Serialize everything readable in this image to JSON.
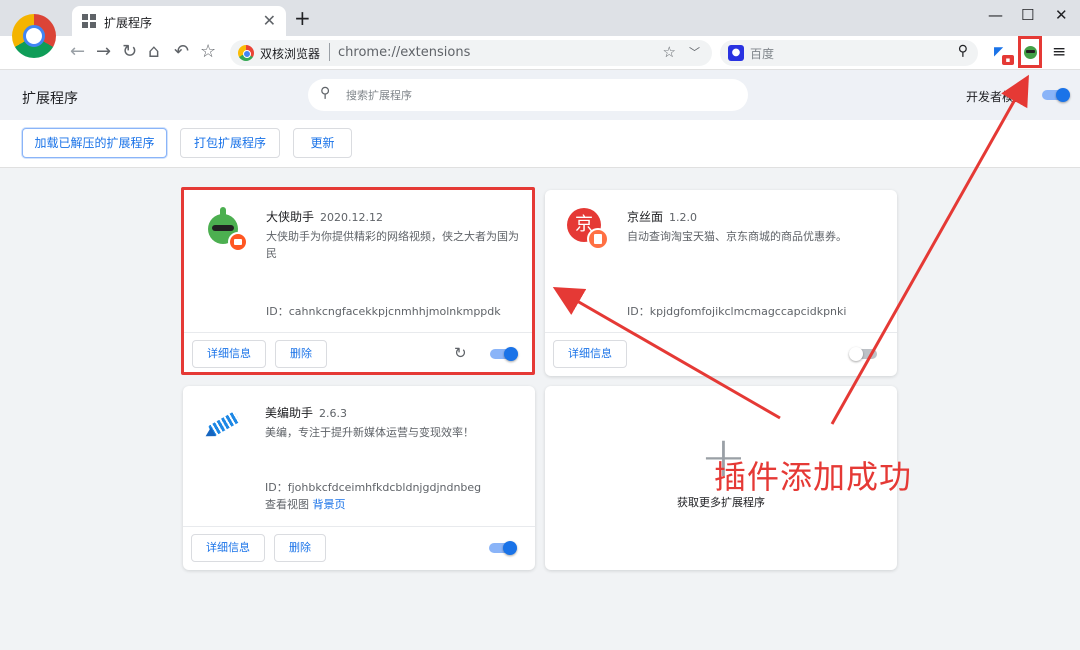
{
  "window": {
    "tab_title": "扩展程序",
    "tab_close": "✕",
    "new_tab": "+",
    "minimize": "—",
    "maximize": "☐",
    "close": "✕"
  },
  "toolbar": {
    "back": "←",
    "forward": "→",
    "reload": "↻",
    "home": "⌂",
    "undo": "↶",
    "bookmark": "☆",
    "browser_name": "双核浏览器",
    "url": "chrome://extensions",
    "search_engine_placeholder": "百度",
    "menu": "≡"
  },
  "header": {
    "title": "扩展程序",
    "search_placeholder": "搜索扩展程序",
    "dev_mode_label": "开发者模式",
    "dev_mode_on": true
  },
  "actions": {
    "load_unpacked": "加载已解压的扩展程序",
    "pack": "打包扩展程序",
    "update": "更新"
  },
  "extensions": [
    {
      "name": "大侠助手",
      "version": "2020.12.12",
      "description": "大侠助手为你提供精彩的网络视频，侠之大者为国为民",
      "id_label": "ID：cahnkcngfacekkpjcnmhhjmolnkmppdk",
      "details_label": "详细信息",
      "remove_label": "删除",
      "enabled": true,
      "icon": "daxia-icon"
    },
    {
      "name": "京丝面",
      "version": "1.2.0",
      "description": "自动查询淘宝天猫、京东商城的商品优惠券。",
      "id_label": "ID：kpjdgfomfojikclmcmagccapcidkpnki",
      "details_label": "详细信息",
      "enabled": false,
      "icon": "jd-coupon-icon",
      "icon_char": "京"
    },
    {
      "name": "美编助手",
      "version": "2.6.3",
      "description": "美编，专注于提升新媒体运营与变现效率！",
      "id_label": "ID：fjohbkcfdceimhfkdcbldnjgdjndnbeg",
      "views_label": "查看视图",
      "views_link": "背景页",
      "details_label": "详细信息",
      "remove_label": "删除",
      "enabled": true,
      "icon": "pen-icon"
    }
  ],
  "more": {
    "plus": "+",
    "label": "获取更多扩展程序"
  },
  "annotation": {
    "text": "插件添加成功",
    "color": "#e53935"
  },
  "colors": {
    "accent": "#1a73e8",
    "highlight": "#e53935"
  }
}
